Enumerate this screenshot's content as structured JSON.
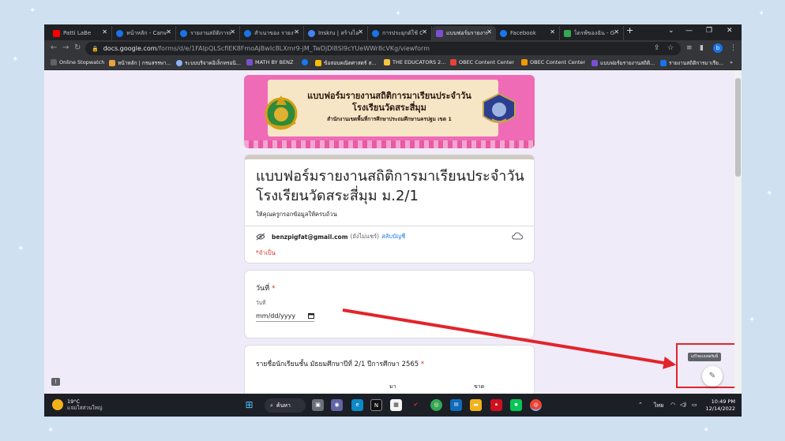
{
  "browser": {
    "tabs": [
      {
        "label": "Patti LaBe",
        "color": "#ff0000",
        "active": false
      },
      {
        "label": "หน้าหลัก - Canv",
        "color": "#1a73e8",
        "active": false
      },
      {
        "label": "รายงานสถิติการมา",
        "color": "#1a73e8",
        "active": false
      },
      {
        "label": "สำเนาของ รายงา",
        "color": "#1a73e8",
        "active": false
      },
      {
        "label": "Inskru | สร้างไอเ",
        "color": "#4285f4",
        "active": false
      },
      {
        "label": "การประยุกต์ใช้ Ca",
        "color": "#1a73e8",
        "active": false
      },
      {
        "label": "แบบฟอร์มรายงาน",
        "color": "#7b4fd1",
        "active": true
      },
      {
        "label": "Facebook",
        "color": "#1877f2",
        "active": false
      },
      {
        "label": "ไดรฟ์ของฉัน - Go",
        "color": "#34a853",
        "active": false
      }
    ],
    "new_tab": "+",
    "url_domain": "docs.google.com",
    "url_path": "/forms/d/e/1FAIpQLScfIEK8FmoAjBwIc8LXmr9-jM_TwDjDl8Sl9cYUeWWr8cVKg/viewform",
    "profile_initial": "b",
    "bookmarks": [
      {
        "label": "Online Stopwatch",
        "color": "#5f6368"
      },
      {
        "label": "หน้าหลัก | กรมสรรพา...",
        "color": "#e8a33d"
      },
      {
        "label": "ระบบบริจาคอิเล็กทรอนิ...",
        "color": "#8ab4f8"
      },
      {
        "label": "MATH BY BENZ",
        "color": "#7b4fd1"
      },
      {
        "label": "",
        "color": "#1877f2"
      },
      {
        "label": "ข้อสอบคณิตศาสตร์ ส...",
        "color": "#fbbc04"
      },
      {
        "label": "THE EDUCATORS 2...",
        "color": "#f5c542"
      },
      {
        "label": "OBEC Content Center",
        "color": "#ea4335"
      },
      {
        "label": "OBEC Content Center",
        "color": "#f29900"
      },
      {
        "label": "แบบฟอร์มรายงานสถิติ...",
        "color": "#7b4fd1"
      },
      {
        "label": "รายงานสถิติการมาเรีย...",
        "color": "#1a73e8"
      }
    ],
    "more_bookmarks": "»"
  },
  "banner": {
    "line1": "แบบฟอร์มรายงานสถิติการมาเรียนประจำวัน",
    "line2": "โรงเรียนวัดสระสี่มุม",
    "line3": "สำนักงานเขตพื้นที่การศึกษาประถมศึกษานครปฐม เขต 1"
  },
  "form": {
    "title": "แบบฟอร์มรายงานสถิติการมาเรียนประจำวัน โรงเรียนวัดสระสี่มุม ม.2/1",
    "description": "ให้คุณครูกรอกข้อมูลให้ครบถ้วน",
    "account_email": "benzpigfat@gmail.com",
    "account_note": "(ยังไม่แชร์)",
    "switch_account": "สลับบัญชี",
    "required_note": "*จำเป็น",
    "date_question": "วันที่",
    "date_sub": "วันที่",
    "date_placeholder": "mm/dd/yyyy",
    "required_mark": "*",
    "student_question": "รายชื่อนักเรียนชั้น มัธยมศึกษาปีที่   2/1  ปีการศึกษา 2565",
    "col_present": "มา",
    "col_absent": "ขาด",
    "edit_tooltip": "แก้ไขแบบฟอร์มนี้"
  },
  "taskbar": {
    "temperature": "19°C",
    "weather_desc": "แจ่มใสส่วนใหญ่",
    "search_label": "ค้นหา",
    "language": "ไทย",
    "time": "10:49 PM",
    "date": "12/14/2022"
  },
  "colors": {
    "accent_red": "#e3242b",
    "form_bg": "#f0ebf8",
    "link": "#1a73e8"
  }
}
